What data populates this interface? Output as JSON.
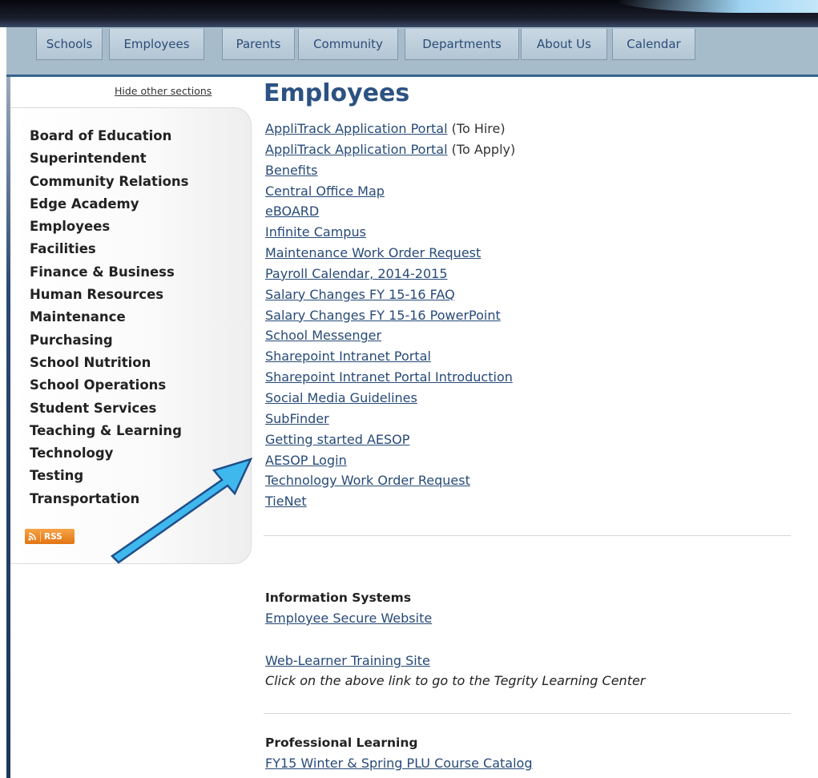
{
  "nav": {
    "tabs": [
      {
        "label": "Schools"
      },
      {
        "label": "Employees"
      },
      {
        "label": "Parents"
      },
      {
        "label": "Community"
      },
      {
        "label": "Departments"
      },
      {
        "label": "About Us"
      },
      {
        "label": "Calendar"
      }
    ]
  },
  "sidebar": {
    "hide_label": "Hide other sections",
    "items": [
      {
        "label": "Board of Education"
      },
      {
        "label": "Superintendent"
      },
      {
        "label": "Community Relations"
      },
      {
        "label": "Edge Academy"
      },
      {
        "label": "Employees"
      },
      {
        "label": "Facilities"
      },
      {
        "label": "Finance & Business"
      },
      {
        "label": "Human Resources"
      },
      {
        "label": "Maintenance"
      },
      {
        "label": "Purchasing"
      },
      {
        "label": "School Nutrition"
      },
      {
        "label": "School Operations"
      },
      {
        "label": "Student Services"
      },
      {
        "label": "Teaching & Learning"
      },
      {
        "label": "Technology"
      },
      {
        "label": "Testing"
      },
      {
        "label": "Transportation"
      }
    ],
    "rss_label": "RSS"
  },
  "main": {
    "title": "Employees",
    "links": [
      {
        "label": "AppliTrack Application Portal",
        "note": " (To Hire)"
      },
      {
        "label": "AppliTrack Application Portal",
        "note": " (To Apply)"
      },
      {
        "label": "Benefits",
        "note": ""
      },
      {
        "label": "Central Office Map",
        "note": ""
      },
      {
        "label": "eBOARD",
        "note": ""
      },
      {
        "label": "Infinite Campus",
        "note": ""
      },
      {
        "label": "Maintenance Work Order Request",
        "note": ""
      },
      {
        "label": "Payroll Calendar, 2014-2015",
        "note": ""
      },
      {
        "label": "Salary Changes FY 15-16 FAQ",
        "note": ""
      },
      {
        "label": "Salary Changes FY 15-16 PowerPoint",
        "note": ""
      },
      {
        "label": "School Messenger",
        "note": ""
      },
      {
        "label": "Sharepoint Intranet Portal",
        "note": ""
      },
      {
        "label": "Sharepoint Intranet Portal Introduction",
        "note": ""
      },
      {
        "label": "Social Media Guidelines",
        "note": ""
      },
      {
        "label": "SubFinder ",
        "note": ""
      },
      {
        "label": "Getting started AESOP",
        "note": ""
      },
      {
        "label": "AESOP Login",
        "note": ""
      },
      {
        "label": "Technology Work Order Request",
        "note": ""
      },
      {
        "label": "TieNet",
        "note": ""
      }
    ],
    "info_systems": {
      "heading": "Information Systems",
      "secure_link": "Employee Secure Website",
      "learner_link": "Web-Learner Training Site",
      "learner_note": "Click on the above link to go to the Tegrity Learning Center"
    },
    "professional_learning": {
      "heading": "Professional Learning",
      "catalog_link": "FY15 Winter & Spring PLU Course Catalog"
    }
  },
  "colors": {
    "nav_bg": "#a7bccb",
    "link": "#274a78",
    "title": "#2c5283",
    "rss": "#e27412",
    "arrow_fill": "#3fb8ee",
    "arrow_stroke": "#1f4f8a"
  }
}
